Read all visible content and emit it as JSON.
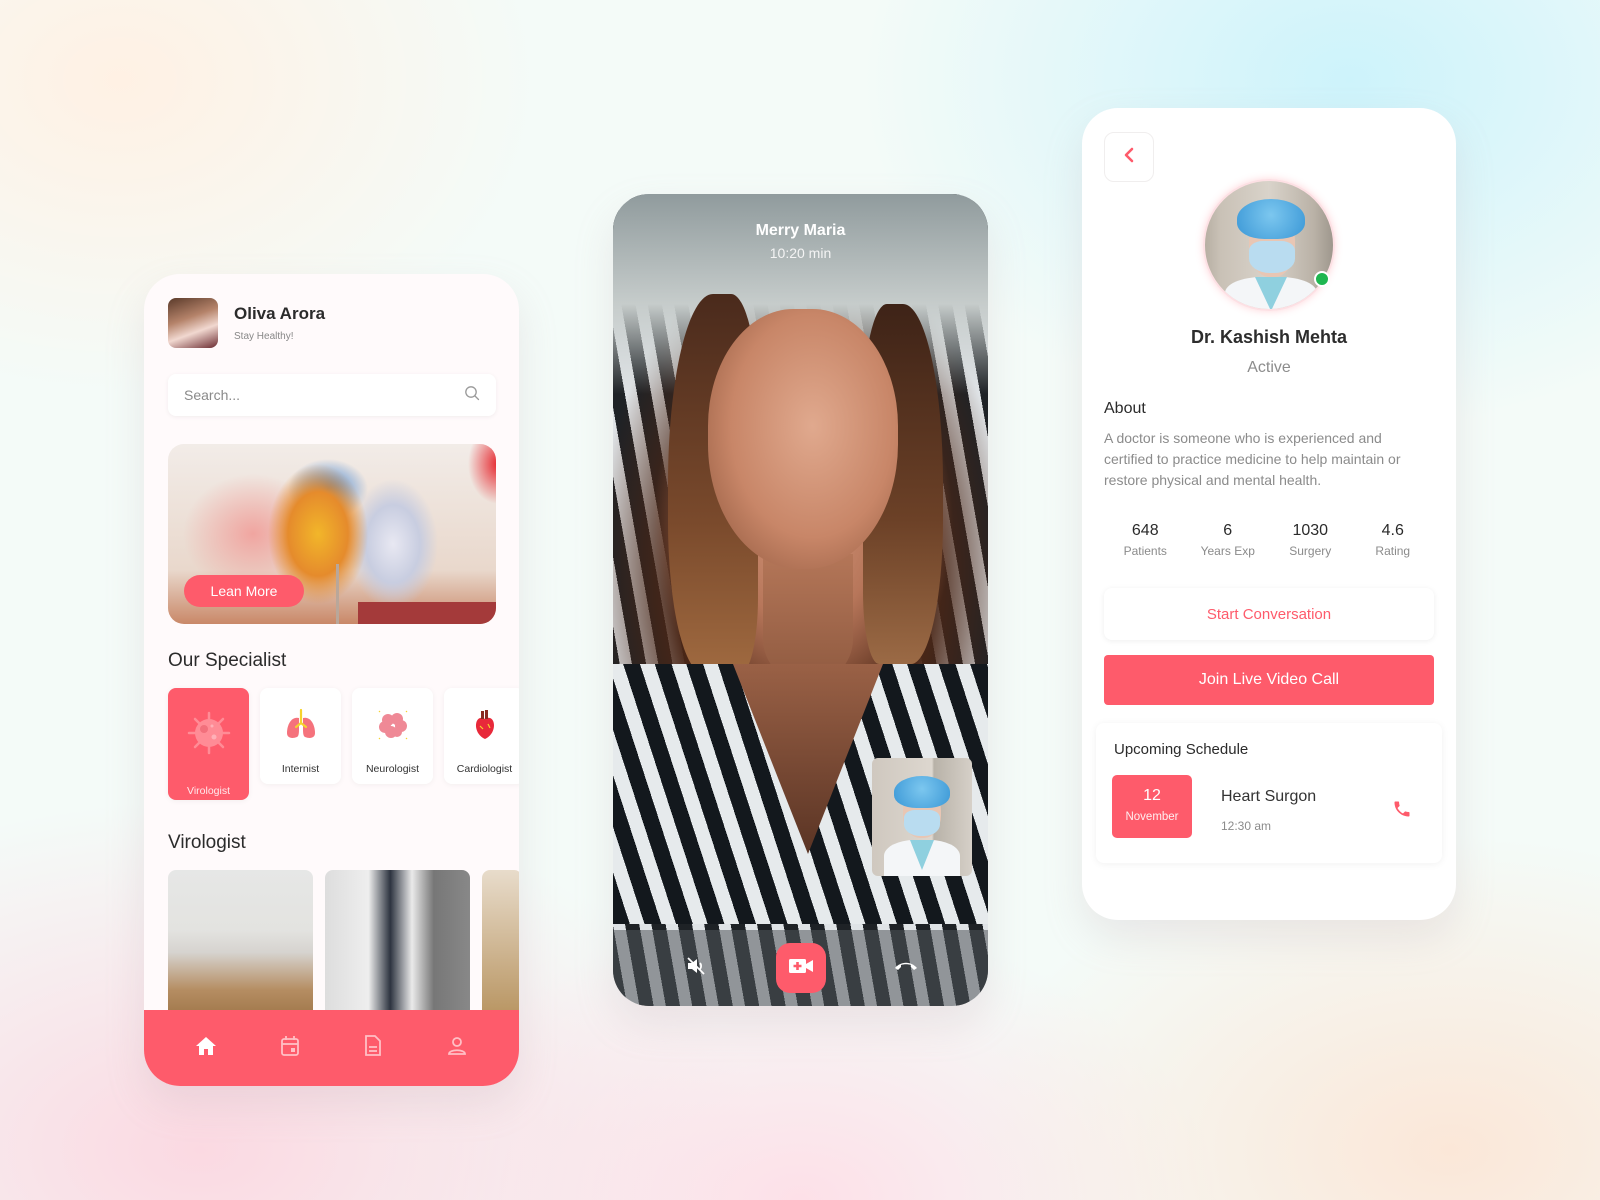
{
  "home": {
    "user": {
      "name": "Oliva Arora",
      "subtitle": "Stay Healthy!"
    },
    "search": {
      "placeholder": "Search..."
    },
    "banner": {
      "button_label": "Lean More"
    },
    "specialist_heading": "Our Specialist",
    "specialists": [
      {
        "label": "Virologist",
        "icon": "virus-icon",
        "active": true
      },
      {
        "label": "Internist",
        "icon": "lungs-icon",
        "active": false
      },
      {
        "label": "Neurologist",
        "icon": "brain-icon",
        "active": false
      },
      {
        "label": "Cardiologist",
        "icon": "heart-icon",
        "active": false
      }
    ],
    "list_heading": "Virologist",
    "tabbar": [
      {
        "icon": "home-icon",
        "active": true
      },
      {
        "icon": "calendar-icon",
        "active": false
      },
      {
        "icon": "document-icon",
        "active": false
      },
      {
        "icon": "profile-icon",
        "active": false
      }
    ]
  },
  "call": {
    "caller_name": "Merry Maria",
    "duration": "10:20 min",
    "controls": [
      {
        "icon": "speaker-mute-icon"
      },
      {
        "icon": "video-camera-plus-icon"
      },
      {
        "icon": "hang-up-icon"
      }
    ]
  },
  "doctor": {
    "name": "Dr. Kashish Mehta",
    "status": "Active",
    "online_color": "#1fb650",
    "about_heading": "About",
    "about_text": "A doctor is someone who is experienced and certified to practice medicine to help maintain or restore physical and mental health.",
    "stats": [
      {
        "value": "648",
        "label": "Patients"
      },
      {
        "value": "6",
        "label": "Years Exp"
      },
      {
        "value": "1030",
        "label": "Surgery"
      },
      {
        "value": "4.6",
        "label": "Rating"
      }
    ],
    "start_conversation_label": "Start Conversation",
    "join_video_label": "Join Live Video Call",
    "schedule": {
      "heading": "Upcoming Schedule",
      "day": "12",
      "month": "November",
      "title": "Heart Surgon",
      "time": "12:30 am"
    }
  },
  "theme": {
    "accent": "#fe5b6b"
  }
}
